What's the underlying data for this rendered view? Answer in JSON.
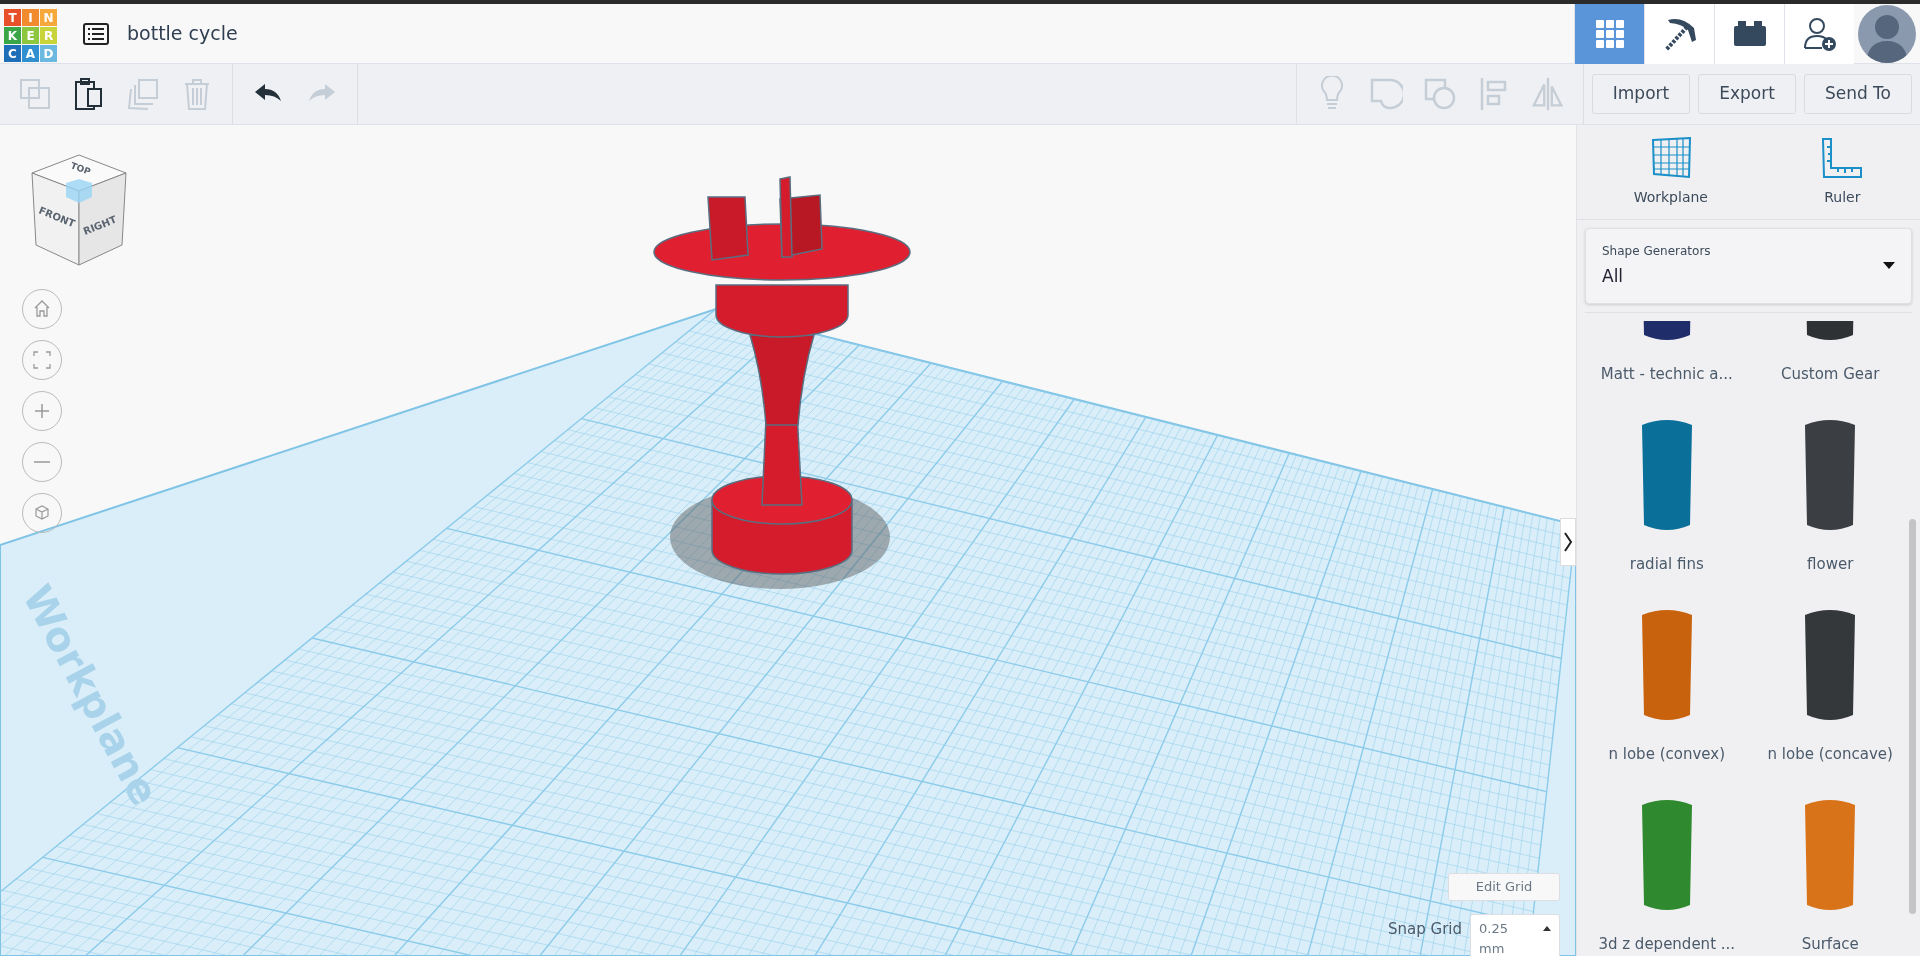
{
  "header": {
    "logo": [
      {
        "letter": "T",
        "color": "#e8502a"
      },
      {
        "letter": "I",
        "color": "#f28a2e"
      },
      {
        "letter": "N",
        "color": "#f7a83a"
      },
      {
        "letter": "K",
        "color": "#3aa648"
      },
      {
        "letter": "E",
        "color": "#8dc63f"
      },
      {
        "letter": "R",
        "color": "#c9d43a"
      },
      {
        "letter": "C",
        "color": "#1e6fb8"
      },
      {
        "letter": "A",
        "color": "#2f8fd0"
      },
      {
        "letter": "D",
        "color": "#6bb8e0"
      }
    ],
    "title": "bottle cycle",
    "views": [
      {
        "kind": "grid",
        "selected": true
      },
      {
        "kind": "pickaxe",
        "selected": false
      },
      {
        "kind": "brick",
        "selected": false
      }
    ]
  },
  "toolbar": {
    "edit_tools": [
      {
        "kind": "copy",
        "disabled": true
      },
      {
        "kind": "paste",
        "disabled": false
      },
      {
        "kind": "duplicate",
        "disabled": true
      },
      {
        "kind": "delete",
        "disabled": true
      }
    ],
    "history": [
      {
        "kind": "undo",
        "disabled": false
      },
      {
        "kind": "redo",
        "disabled": true
      }
    ],
    "shape_tools": [
      {
        "kind": "bulb",
        "disabled": true
      },
      {
        "kind": "group",
        "disabled": true
      },
      {
        "kind": "ungroup",
        "disabled": true
      },
      {
        "kind": "align",
        "disabled": true
      },
      {
        "kind": "mirror",
        "disabled": true
      }
    ],
    "buttons": [
      "Import",
      "Export",
      "Send To"
    ]
  },
  "viewport": {
    "view_cube": {
      "top": "TOP",
      "front": "FRONT",
      "right": "RIGHT"
    },
    "nav_buttons": [
      {
        "kind": "home"
      },
      {
        "kind": "fit"
      },
      {
        "kind": "zoom-in"
      },
      {
        "kind": "zoom-out"
      },
      {
        "kind": "perspective"
      }
    ],
    "plane_label": "Workplane",
    "edit_grid": "Edit Grid",
    "snap_grid": {
      "label": "Snap Grid",
      "value": "0.25",
      "unit": "mm"
    }
  },
  "panel": {
    "tools": [
      {
        "kind": "workplane",
        "label": "Workplane"
      },
      {
        "kind": "ruler",
        "label": "Ruler"
      }
    ],
    "category": {
      "label": "Shape Generators",
      "value": "All"
    },
    "shapes": [
      {
        "label": "Matt - technic a...",
        "color": "#1f2d6b"
      },
      {
        "label": "Custom Gear",
        "color": "#2f3235"
      },
      {
        "label": "radial fins",
        "color": "#0a6f99"
      },
      {
        "label": "flower",
        "color": "#3b3e42"
      },
      {
        "label": "n lobe (convex)",
        "color": "#c8620d"
      },
      {
        "label": "n lobe (concave)",
        "color": "#35383b"
      },
      {
        "label": "3d z dependent ...",
        "color": "#2f8a2f"
      },
      {
        "label": "Surface",
        "color": "#d9731a"
      }
    ]
  }
}
